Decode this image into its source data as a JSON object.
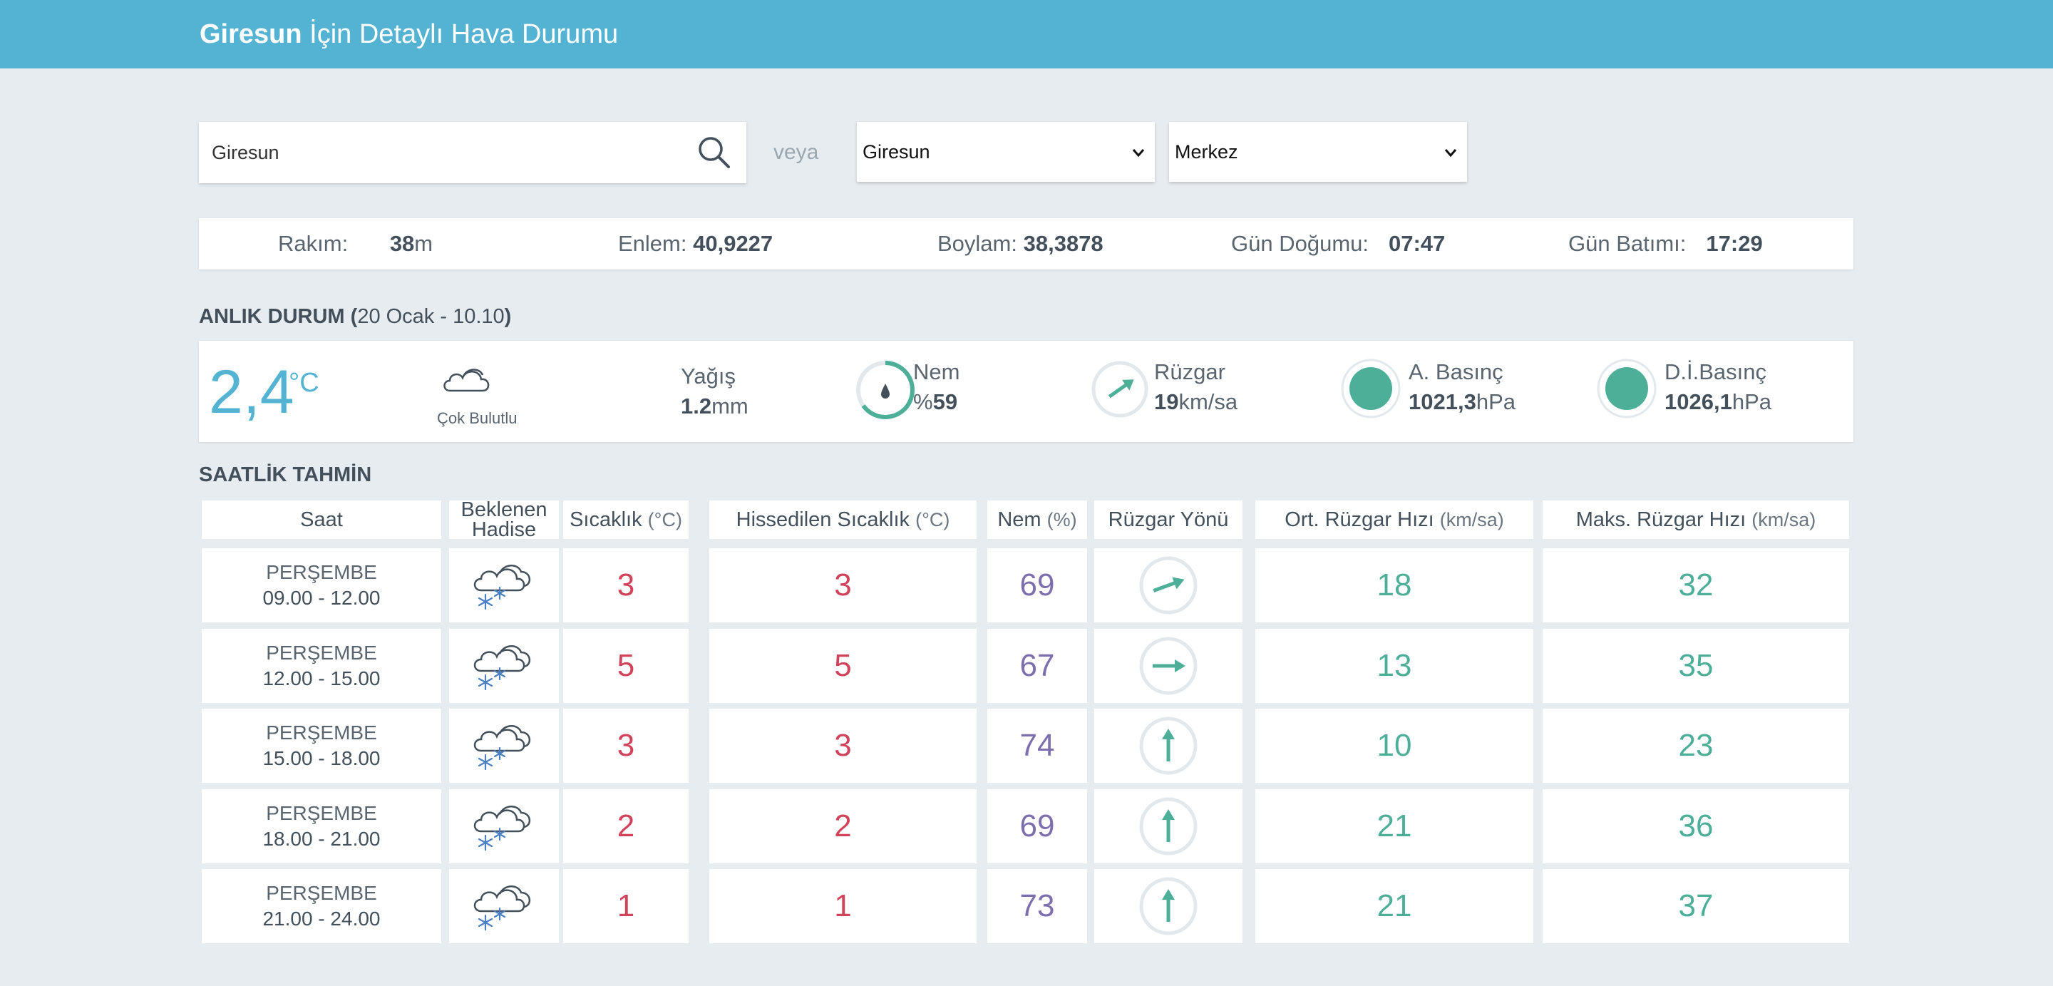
{
  "header": {
    "city": "Giresun",
    "title_rest": "İçin Detaylı Hava Durumu"
  },
  "search": {
    "value": "Giresun",
    "veya": "veya"
  },
  "selects": {
    "il": "Giresun",
    "ilce": "Merkez"
  },
  "info": {
    "rakim_label": "Rakım:",
    "rakim_value": "38",
    "rakim_unit": "m",
    "enlem_label": "Enlem:",
    "enlem_value": "40,9227",
    "boylam_label": "Boylam:",
    "boylam_value": "38,3878",
    "dogum_label": "Gün Doğumu:",
    "dogum_value": "07:47",
    "batim_label": "Gün Batımı:",
    "batim_value": "17:29"
  },
  "current": {
    "section_title": "ANLIK DURUM (",
    "section_date": "20 Ocak - 10.10",
    "section_close": ")",
    "temp": "2,4",
    "temp_unit": "°C",
    "condition": "Çok Bulutlu",
    "yagis_label": "Yağış",
    "yagis_value": "1.2",
    "yagis_unit": "mm",
    "nem_label": "Nem",
    "nem_prefix": "%",
    "nem_value": "59",
    "ruzgar_label": "Rüzgar",
    "ruzgar_value": "19",
    "ruzgar_unit": "km/sa",
    "abasinc_label": "A. Basınç",
    "abasinc_value": "1021,3",
    "abasinc_unit": "hPa",
    "dbasinc_label": "D.İ.Basınç",
    "dbasinc_value": "1026,1",
    "dbasinc_unit": "hPa",
    "colors": {
      "accent": "#54b3d3",
      "green": "#4daf98"
    }
  },
  "hourly": {
    "section_title": "SAATLİK TAHMİN",
    "headers": {
      "saat": "Saat",
      "hadise1": "Beklenen",
      "hadise2": "Hadise",
      "sicaklik": "Sıcaklık",
      "sicaklik_unit": "(°C)",
      "hissedilen": "Hissedilen Sıcaklık",
      "hissedilen_unit": "(°C)",
      "nem": "Nem",
      "nem_unit": "(%)",
      "yon": "Rüzgar Yönü",
      "ort": "Ort. Rüzgar Hızı",
      "ort_unit": "(km/sa)",
      "maks": "Maks. Rüzgar Hızı",
      "maks_unit": "(km/sa)"
    },
    "rows": [
      {
        "day": "PERŞEMBE",
        "time": "09.00 - 12.00",
        "icon": "cloud-snow-icon",
        "temp": "3",
        "feels": "3",
        "hum": "69",
        "wind_dir_deg": 70,
        "avg": "18",
        "max": "32"
      },
      {
        "day": "PERŞEMBE",
        "time": "12.00 - 15.00",
        "icon": "cloud-snow-icon",
        "temp": "5",
        "feels": "5",
        "hum": "67",
        "wind_dir_deg": 90,
        "avg": "13",
        "max": "35"
      },
      {
        "day": "PERŞEMBE",
        "time": "15.00 - 18.00",
        "icon": "cloud-snow-icon",
        "temp": "3",
        "feels": "3",
        "hum": "74",
        "wind_dir_deg": 0,
        "avg": "10",
        "max": "23"
      },
      {
        "day": "PERŞEMBE",
        "time": "18.00 - 21.00",
        "icon": "cloud-snow-icon",
        "temp": "2",
        "feels": "2",
        "hum": "69",
        "wind_dir_deg": 0,
        "avg": "21",
        "max": "36"
      },
      {
        "day": "PERŞEMBE",
        "time": "21.00 - 24.00",
        "icon": "cloud-snow-icon",
        "temp": "1",
        "feels": "1",
        "hum": "73",
        "wind_dir_deg": 0,
        "avg": "21",
        "max": "37"
      }
    ]
  }
}
